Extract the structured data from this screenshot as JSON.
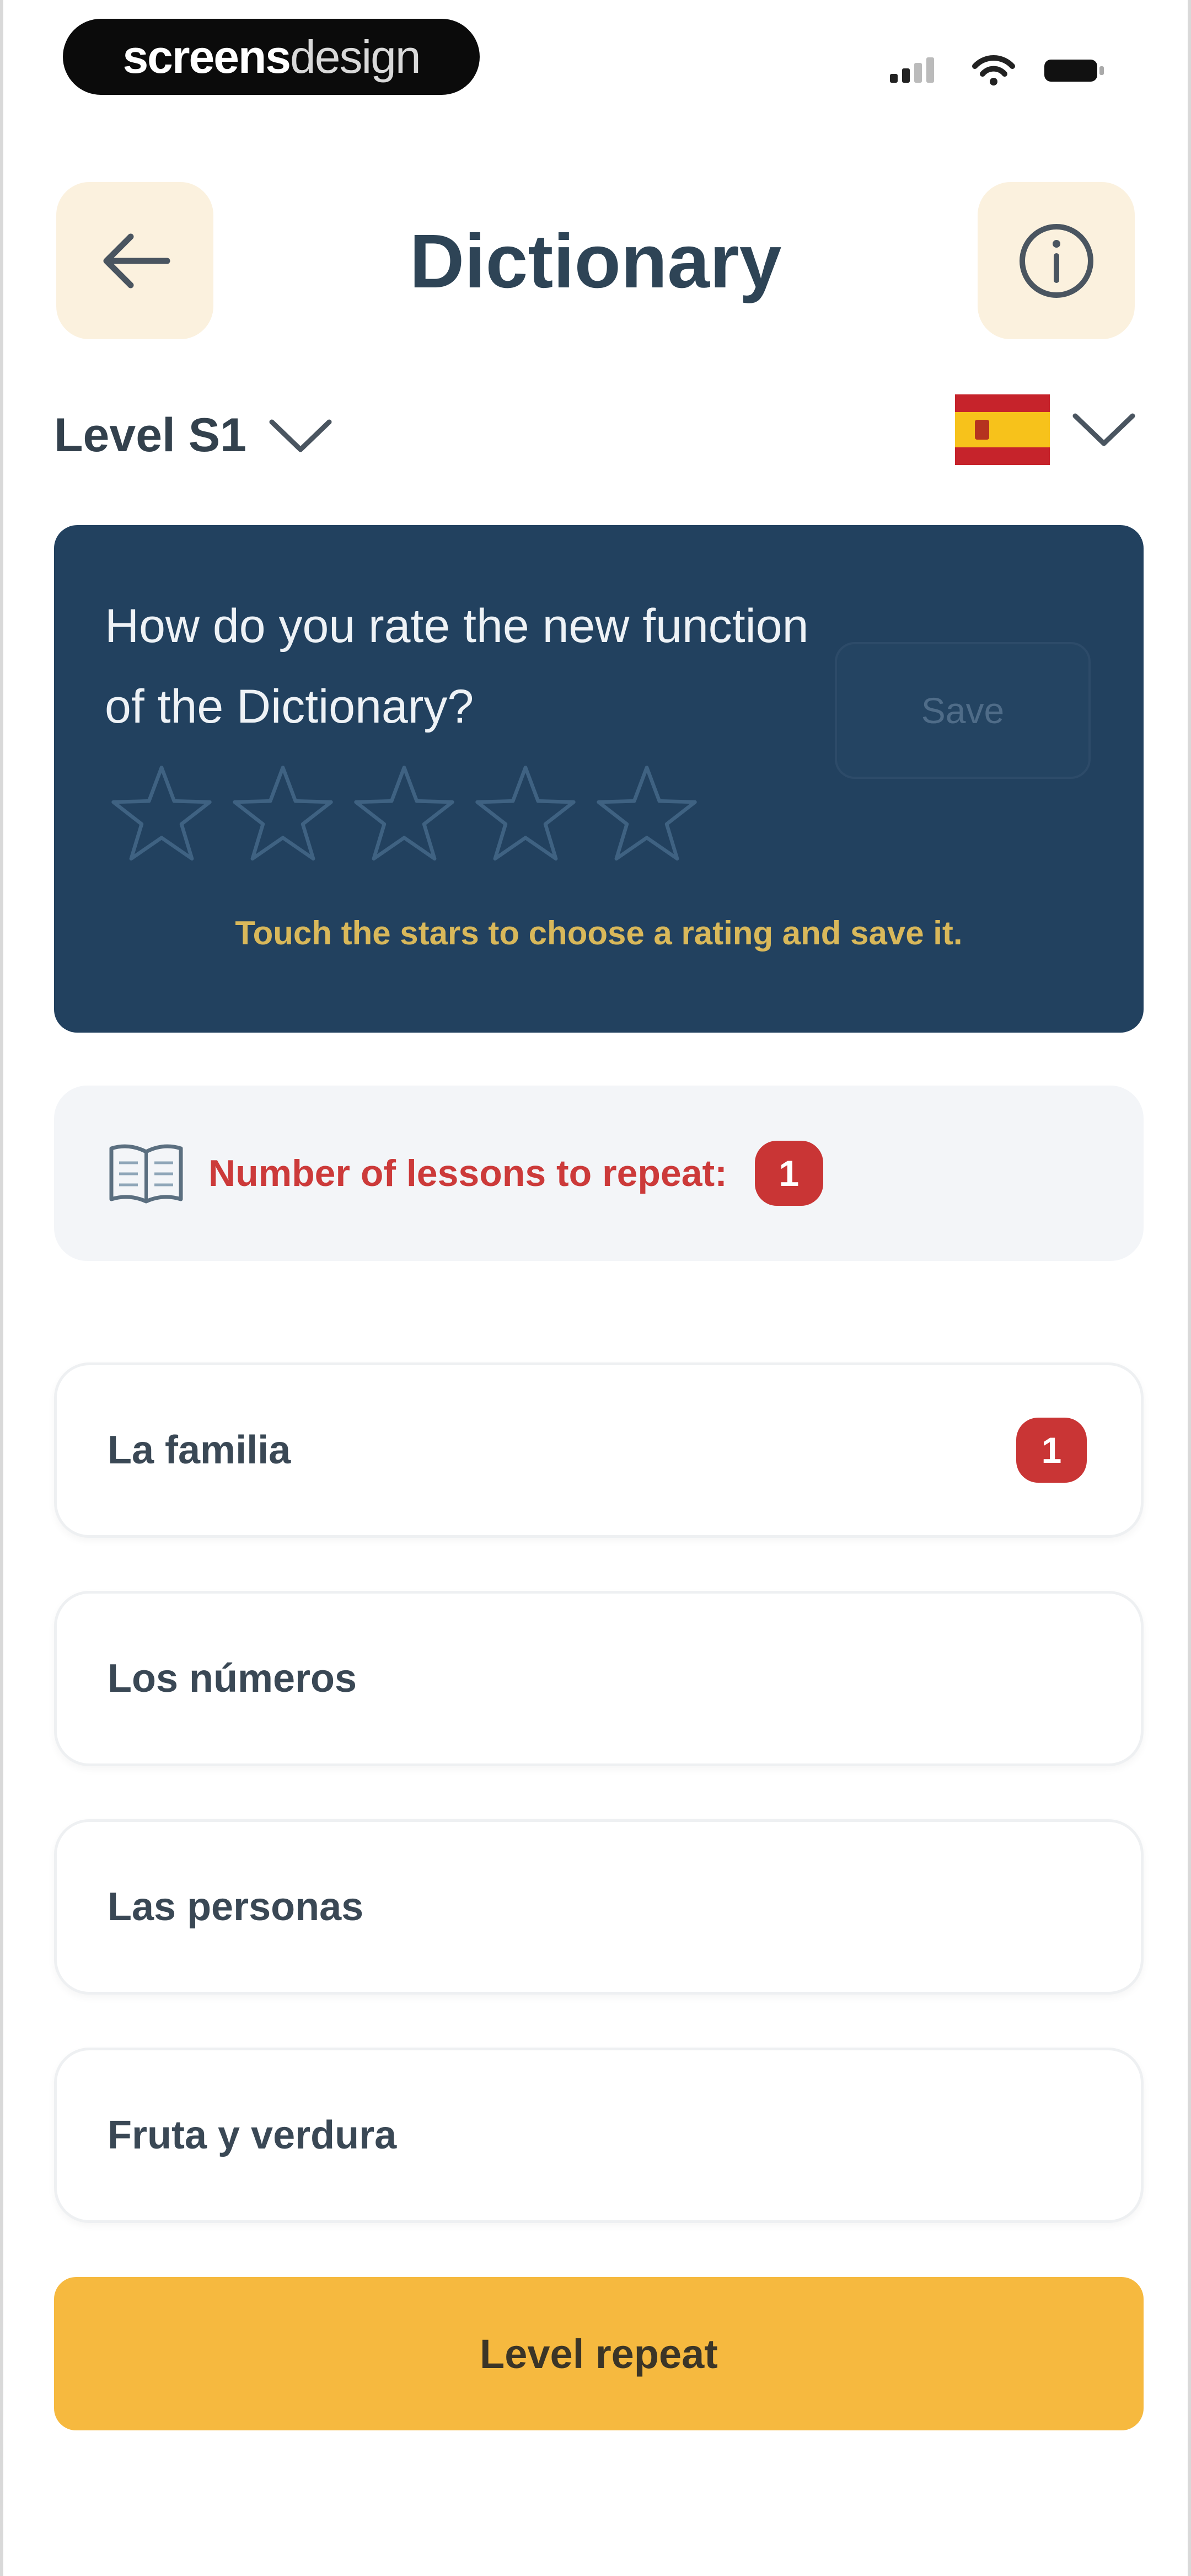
{
  "watermark": {
    "bold": "screens",
    "light": "design"
  },
  "header": {
    "title": "Dictionary"
  },
  "filters": {
    "level": "Level S1"
  },
  "rating": {
    "question": "How do you rate the new function of the Dictionary?",
    "save_label": "Save",
    "rating_value": 0,
    "max_stars": 5,
    "hint": "Touch the stars to choose a rating and save it."
  },
  "repeat": {
    "label": "Number of lessons to repeat:",
    "count": "1"
  },
  "lessons": [
    {
      "name": "La familia",
      "badge": "1"
    },
    {
      "name": "Los números"
    },
    {
      "name": "Las personas"
    },
    {
      "name": "Fruta y verdura"
    }
  ],
  "footer": {
    "button_label": "Level repeat"
  },
  "colors": {
    "card_bg": "#22415f",
    "accent_yellow": "#f6b93f",
    "alert_red": "#c93535",
    "header_btn_bg": "#fbf1de"
  }
}
